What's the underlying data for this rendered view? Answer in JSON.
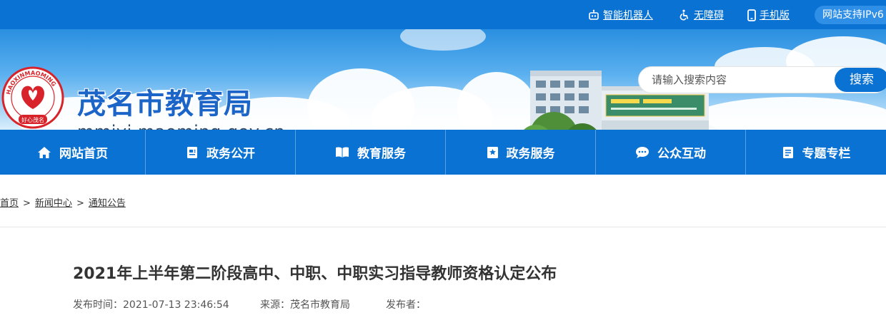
{
  "topbar": {
    "robot_label": "智能机器人",
    "accessibility_label": "无障碍",
    "mobile_label": "手机版",
    "ipv6_label": "网站支持IPv6"
  },
  "header": {
    "title": "茂名市教育局",
    "url": "mmjyj.maoming.gov.cn",
    "logo_text": "HAOXINMAOMING 好心茂名"
  },
  "search": {
    "placeholder": "请输入搜索内容",
    "button_label": "搜索"
  },
  "nav": {
    "items": [
      {
        "label": "网站首页",
        "icon": "home-icon"
      },
      {
        "label": "政务公开",
        "icon": "document-icon"
      },
      {
        "label": "教育服务",
        "icon": "book-icon"
      },
      {
        "label": "政务服务",
        "icon": "bookmark-star-icon"
      },
      {
        "label": "公众互动",
        "icon": "chat-icon"
      },
      {
        "label": "专题专栏",
        "icon": "notes-icon"
      }
    ]
  },
  "breadcrumb": {
    "items": [
      "首页",
      "新闻中心",
      "通知公告"
    ],
    "separator": ">"
  },
  "article": {
    "title": "2021年上半年第二阶段高中、中职、中职实习指导教师资格认定公布",
    "publish_time": "发布时间：2021-07-13 23:46:54",
    "source": "来源：茂名市教育局",
    "publisher": "发布者："
  },
  "colors": {
    "primary": "#0a72d2",
    "title": "#1b64c8",
    "logo_red": "#d8232a"
  }
}
